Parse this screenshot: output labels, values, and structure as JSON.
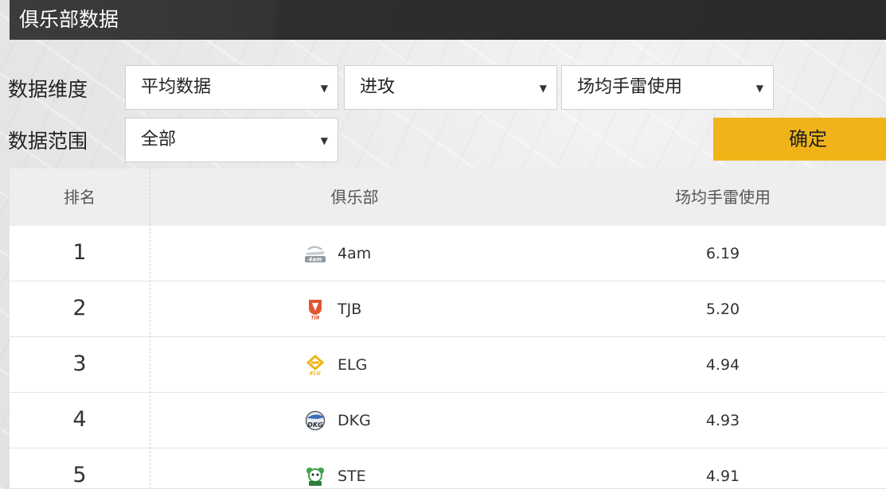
{
  "header": {
    "title": "俱乐部数据"
  },
  "filters": {
    "dimension_label": "数据维度",
    "range_label": "数据范围",
    "dimension_type": "平均数据",
    "category": "进攻",
    "metric": "场均手雷使用",
    "range": "全部",
    "confirm_label": "确定"
  },
  "table": {
    "columns": [
      "排名",
      "俱乐部",
      "场均手雷使用"
    ],
    "rows": [
      {
        "rank": "1",
        "club": "4am",
        "value": "6.19",
        "logo": "4am-logo",
        "logo_color": "#9aa4ad"
      },
      {
        "rank": "2",
        "club": "TJB",
        "value": "5.20",
        "logo": "tjb-logo",
        "logo_color": "#e4572e"
      },
      {
        "rank": "3",
        "club": "ELG",
        "value": "4.94",
        "logo": "elg-logo",
        "logo_color": "#f0b419"
      },
      {
        "rank": "4",
        "club": "DKG",
        "value": "4.93",
        "logo": "dkg-logo",
        "logo_color": "#3b6fb6"
      },
      {
        "rank": "5",
        "club": "STE",
        "value": "4.91",
        "logo": "ste-logo",
        "logo_color": "#3fa34d"
      }
    ]
  },
  "colors": {
    "accent": "#f0b419",
    "header_bg": "#2e2e2e"
  },
  "icons": {
    "caret": "caret-down-icon"
  }
}
